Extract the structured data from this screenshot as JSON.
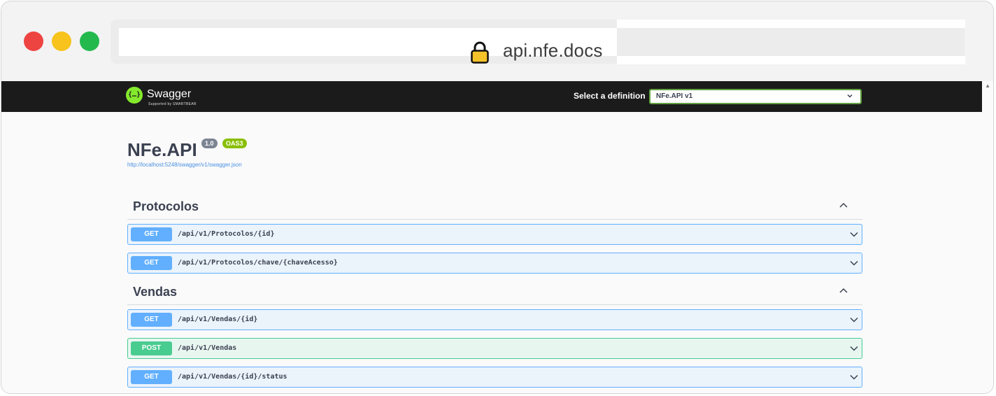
{
  "browser": {
    "url": "api.nfe.docs"
  },
  "swagger": {
    "logo_name": "Swagger",
    "logo_sub": "Supported by SMARTBEAR",
    "definition_label": "Select a definition",
    "definition_selected": "NFe.API v1"
  },
  "info": {
    "title": "NFe.API",
    "version": "1.0",
    "oas": "OAS3",
    "spec_url": "http://localhost:5248/swagger/v1/swagger.json"
  },
  "tags": [
    {
      "name": "Protocolos",
      "operations": [
        {
          "method": "GET",
          "path": "/api/v1/Protocolos/{id}"
        },
        {
          "method": "GET",
          "path": "/api/v1/Protocolos/chave/{chaveAcesso}"
        }
      ]
    },
    {
      "name": "Vendas",
      "operations": [
        {
          "method": "GET",
          "path": "/api/v1/Vendas/{id}"
        },
        {
          "method": "POST",
          "path": "/api/v1/Vendas"
        },
        {
          "method": "GET",
          "path": "/api/v1/Vendas/{id}/status"
        }
      ]
    }
  ],
  "colors": {
    "get": "#61affe",
    "post": "#49cc90",
    "topbar": "#1b1b1b"
  }
}
